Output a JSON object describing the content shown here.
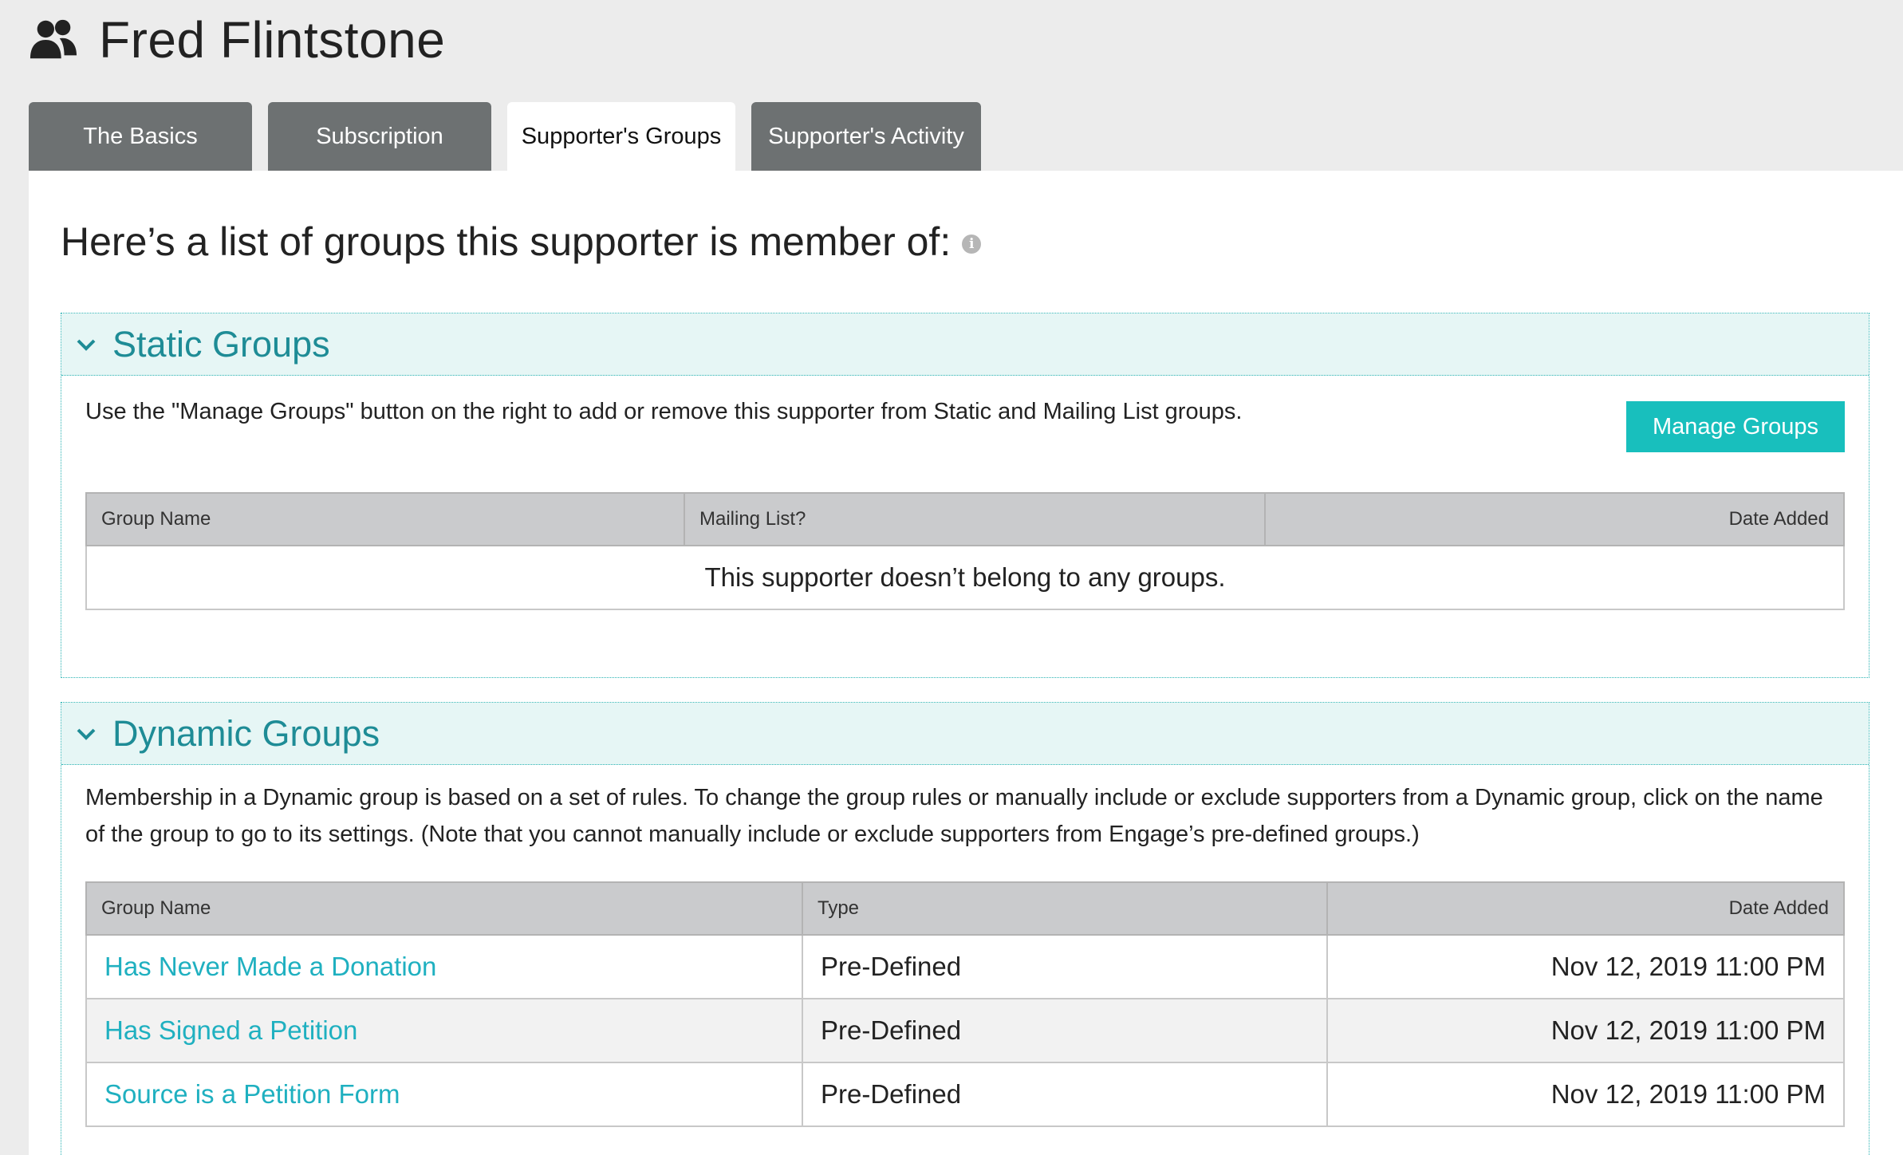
{
  "header": {
    "title": "Fred Flintstone",
    "icon": "users-icon"
  },
  "tabs": [
    {
      "label": "The Basics",
      "active": false
    },
    {
      "label": "Subscription",
      "active": false
    },
    {
      "label": "Supporter's Groups",
      "active": true
    },
    {
      "label": "Supporter's Activity",
      "active": false
    }
  ],
  "page": {
    "heading": "Here’s a list of groups this supporter is member of:",
    "info_icon": "i"
  },
  "static_groups": {
    "title": "Static Groups",
    "description": "Use the \"Manage Groups\" button on the right to add or remove this supporter from Static and Mailing List groups.",
    "manage_button": "Manage Groups",
    "columns": [
      "Group Name",
      "Mailing List?",
      "Date Added"
    ],
    "empty_message": "This supporter doesn’t belong to any groups."
  },
  "dynamic_groups": {
    "title": "Dynamic Groups",
    "description": "Membership in a Dynamic group is based on a set of rules. To change the group rules or manually include or exclude supporters from a Dynamic group, click on the name of the group to go to its settings. (Note that you cannot manually include or exclude supporters from Engage’s pre-defined groups.)",
    "columns": [
      "Group Name",
      "Type",
      "Date Added"
    ],
    "rows": [
      {
        "name": "Has Never Made a Donation",
        "type": "Pre-Defined",
        "date": "Nov 12, 2019 11:00 PM"
      },
      {
        "name": "Has Signed a Petition",
        "type": "Pre-Defined",
        "date": "Nov 12, 2019 11:00 PM"
      },
      {
        "name": "Source is a Petition Form",
        "type": "Pre-Defined",
        "date": "Nov 12, 2019 11:00 PM"
      }
    ]
  },
  "colors": {
    "accent": "#18bfbd",
    "link": "#1fb0c0",
    "group_title": "#1e8c96",
    "tab_bg": "#6d7172"
  }
}
